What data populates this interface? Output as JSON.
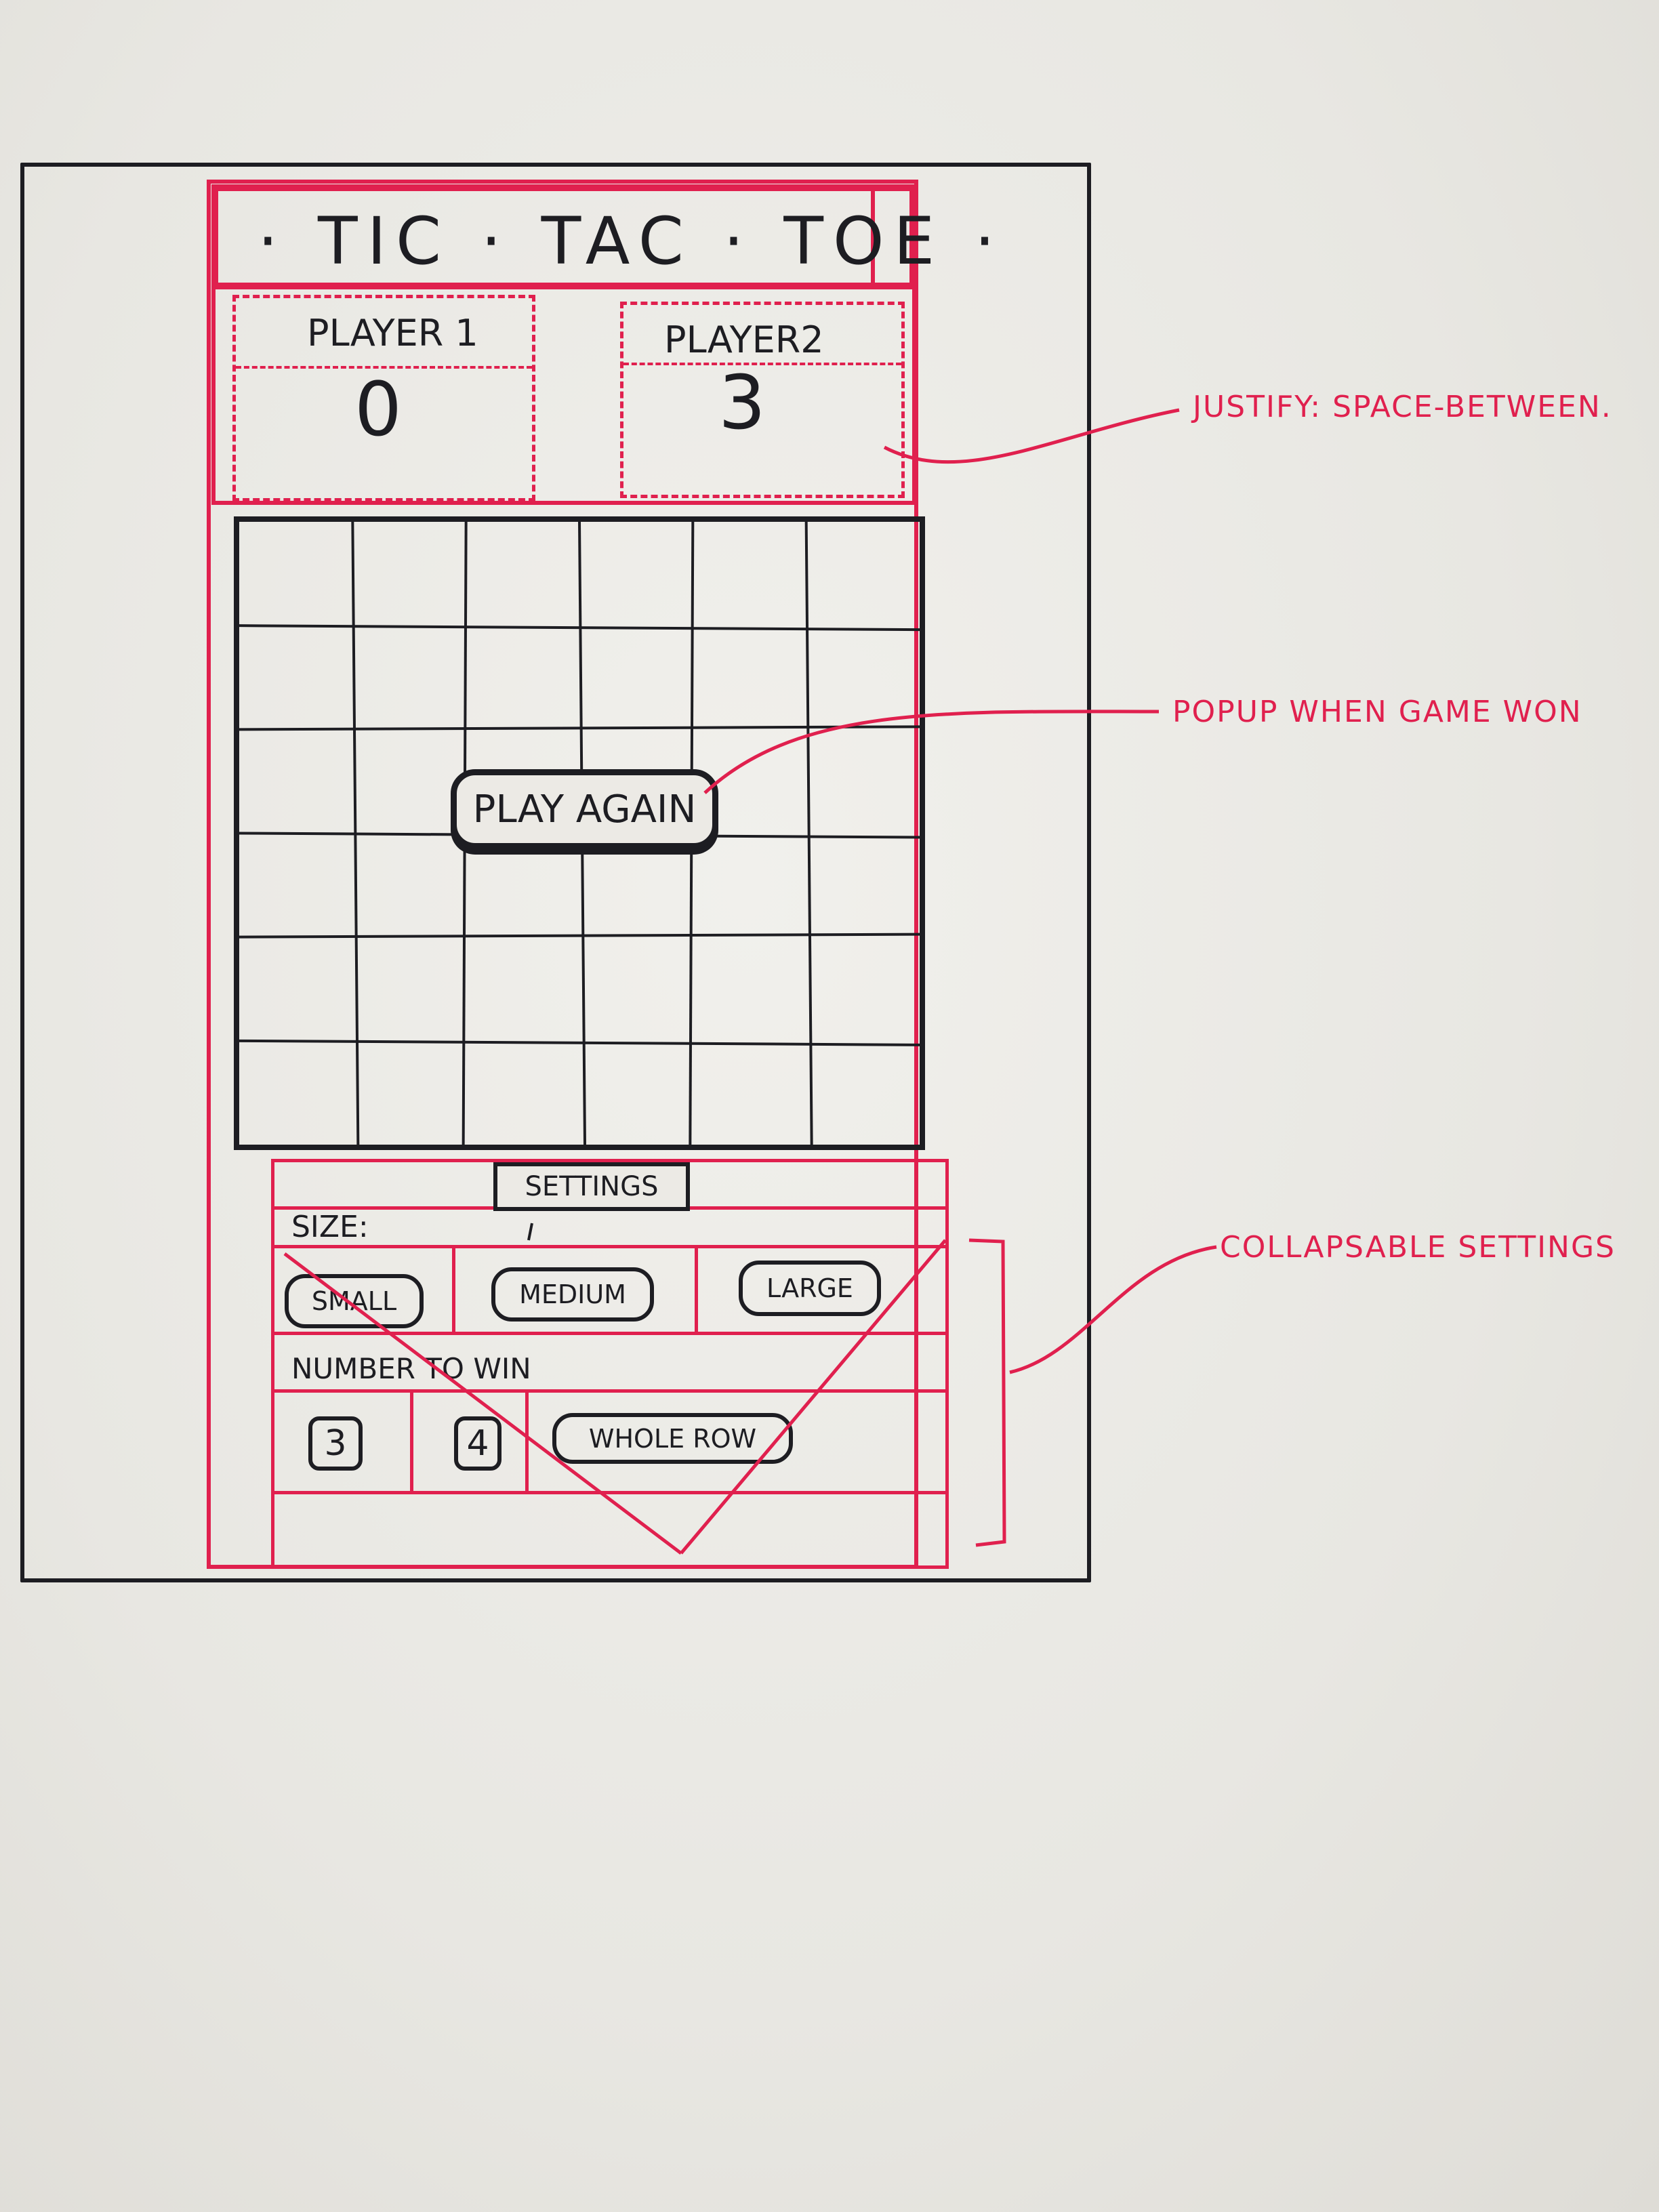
{
  "header": {
    "title": "· TIC · TAC · TOE ·"
  },
  "players": [
    {
      "name": "PLAYER 1",
      "score": "0"
    },
    {
      "name": "PLAYER2",
      "score": "3"
    }
  ],
  "board": {
    "rows": 6,
    "cols": 6
  },
  "popup": {
    "label": "PLAY AGAIN"
  },
  "settings": {
    "toggle_label": "SETTINGS",
    "size_label": "SIZE:",
    "size_options": [
      "SMALL",
      "MEDIUM",
      "LARGE"
    ],
    "win_label": "NUMBER TO WIN",
    "win_options": [
      "3",
      "4",
      "WHOLE ROW"
    ]
  },
  "annotations": {
    "justify": "JUSTIFY: SPACE-BETWEEN.",
    "popup": "POPUP  WHEN GAME WON",
    "collapsible": "COLLAPSABLE  SETTINGS"
  },
  "colors": {
    "ink": "#1d1d22",
    "accent": "#e0204e",
    "paper": "#eceae5"
  }
}
